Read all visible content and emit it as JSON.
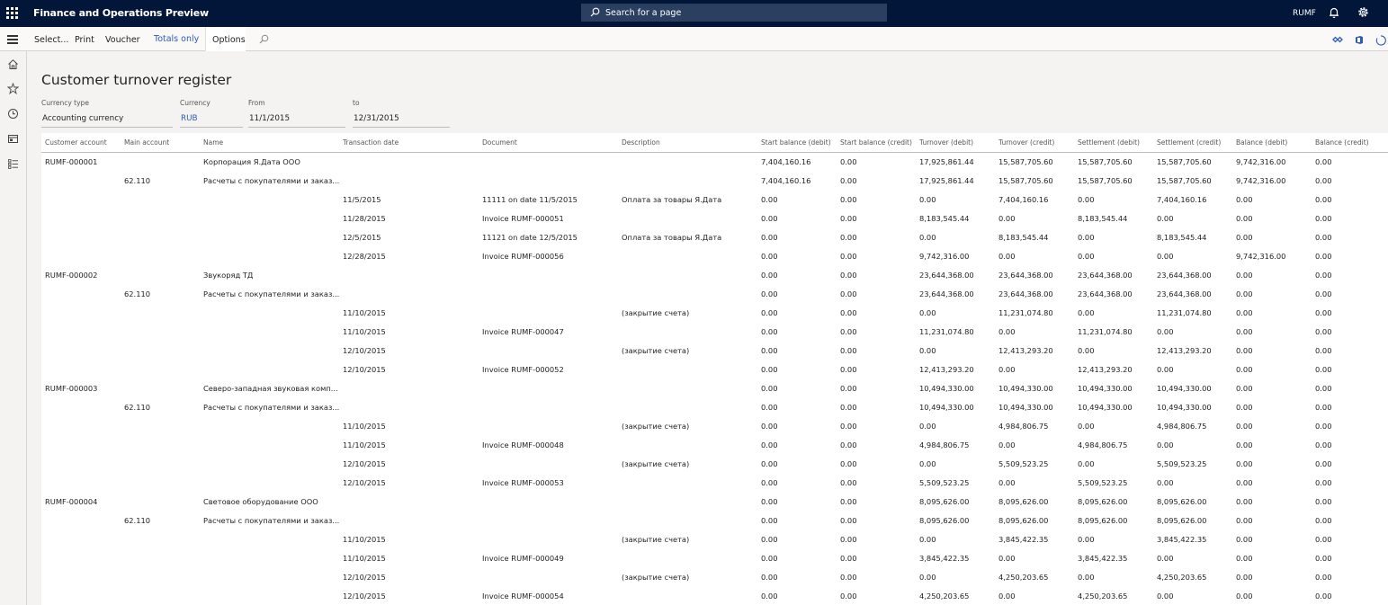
{
  "topbar": {
    "app_title": "Finance and Operations Preview",
    "search_placeholder": "Search for a page",
    "company": "RUMF"
  },
  "actions": {
    "select": "Select...",
    "print": "Print",
    "voucher": "Voucher",
    "totals_only": "Totals only",
    "options": "Options"
  },
  "page": {
    "title": "Customer turnover register"
  },
  "filters": {
    "currency_type": {
      "label": "Currency type",
      "value": "Accounting currency"
    },
    "currency": {
      "label": "Currency",
      "value": "RUB"
    },
    "from": {
      "label": "From",
      "value": "11/1/2015"
    },
    "to": {
      "label": "to",
      "value": "12/31/2015"
    }
  },
  "grid": {
    "columns": [
      "Customer account",
      "Main account",
      "Name",
      "Transaction date",
      "Document",
      "Description",
      "Start balance (debit)",
      "Start balance (credit)",
      "Turnover (debit)",
      "Turnover (credit)",
      "Settlement (debit)",
      "Settlement (credit)",
      "Balance (debit)",
      "Balance (credit)"
    ],
    "rows": [
      [
        "RUMF-000001",
        "",
        "Корпорация Я.Дата ООО",
        "",
        "",
        "",
        "7,404,160.16",
        "0.00",
        "17,925,861.44",
        "15,587,705.60",
        "15,587,705.60",
        "15,587,705.60",
        "9,742,316.00",
        "0.00"
      ],
      [
        "",
        "62.110",
        "Расчеты с покупателями и заказ...",
        "",
        "",
        "",
        "7,404,160.16",
        "0.00",
        "17,925,861.44",
        "15,587,705.60",
        "15,587,705.60",
        "15,587,705.60",
        "9,742,316.00",
        "0.00"
      ],
      [
        "",
        "",
        "",
        "11/5/2015",
        "11111 on date 11/5/2015",
        "Оплата за товары Я.Дата",
        "0.00",
        "0.00",
        "0.00",
        "7,404,160.16",
        "0.00",
        "7,404,160.16",
        "0.00",
        "0.00"
      ],
      [
        "",
        "",
        "",
        "11/28/2015",
        "Invoice RUMF-000051",
        "",
        "0.00",
        "0.00",
        "8,183,545.44",
        "0.00",
        "8,183,545.44",
        "0.00",
        "0.00",
        "0.00"
      ],
      [
        "",
        "",
        "",
        "12/5/2015",
        "11121 on date 12/5/2015",
        "Оплата за товары Я.Дата",
        "0.00",
        "0.00",
        "0.00",
        "8,183,545.44",
        "0.00",
        "8,183,545.44",
        "0.00",
        "0.00"
      ],
      [
        "",
        "",
        "",
        "12/28/2015",
        "Invoice RUMF-000056",
        "",
        "0.00",
        "0.00",
        "9,742,316.00",
        "0.00",
        "0.00",
        "0.00",
        "9,742,316.00",
        "0.00"
      ],
      [
        "RUMF-000002",
        "",
        "Звукоряд ТД",
        "",
        "",
        "",
        "0.00",
        "0.00",
        "23,644,368.00",
        "23,644,368.00",
        "23,644,368.00",
        "23,644,368.00",
        "0.00",
        "0.00"
      ],
      [
        "",
        "62.110",
        "Расчеты с покупателями и заказ...",
        "",
        "",
        "",
        "0.00",
        "0.00",
        "23,644,368.00",
        "23,644,368.00",
        "23,644,368.00",
        "23,644,368.00",
        "0.00",
        "0.00"
      ],
      [
        "",
        "",
        "",
        "11/10/2015",
        "",
        "(закрытие счета)",
        "0.00",
        "0.00",
        "0.00",
        "11,231,074.80",
        "0.00",
        "11,231,074.80",
        "0.00",
        "0.00"
      ],
      [
        "",
        "",
        "",
        "11/10/2015",
        "Invoice RUMF-000047",
        "",
        "0.00",
        "0.00",
        "11,231,074.80",
        "0.00",
        "11,231,074.80",
        "0.00",
        "0.00",
        "0.00"
      ],
      [
        "",
        "",
        "",
        "12/10/2015",
        "",
        "(закрытие счета)",
        "0.00",
        "0.00",
        "0.00",
        "12,413,293.20",
        "0.00",
        "12,413,293.20",
        "0.00",
        "0.00"
      ],
      [
        "",
        "",
        "",
        "12/10/2015",
        "Invoice RUMF-000052",
        "",
        "0.00",
        "0.00",
        "12,413,293.20",
        "0.00",
        "12,413,293.20",
        "0.00",
        "0.00",
        "0.00"
      ],
      [
        "RUMF-000003",
        "",
        "Северо-западная звуковая комп...",
        "",
        "",
        "",
        "0.00",
        "0.00",
        "10,494,330.00",
        "10,494,330.00",
        "10,494,330.00",
        "10,494,330.00",
        "0.00",
        "0.00"
      ],
      [
        "",
        "62.110",
        "Расчеты с покупателями и заказ...",
        "",
        "",
        "",
        "0.00",
        "0.00",
        "10,494,330.00",
        "10,494,330.00",
        "10,494,330.00",
        "10,494,330.00",
        "0.00",
        "0.00"
      ],
      [
        "",
        "",
        "",
        "11/10/2015",
        "",
        "(закрытие счета)",
        "0.00",
        "0.00",
        "0.00",
        "4,984,806.75",
        "0.00",
        "4,984,806.75",
        "0.00",
        "0.00"
      ],
      [
        "",
        "",
        "",
        "11/10/2015",
        "Invoice RUMF-000048",
        "",
        "0.00",
        "0.00",
        "4,984,806.75",
        "0.00",
        "4,984,806.75",
        "0.00",
        "0.00",
        "0.00"
      ],
      [
        "",
        "",
        "",
        "12/10/2015",
        "",
        "(закрытие счета)",
        "0.00",
        "0.00",
        "0.00",
        "5,509,523.25",
        "0.00",
        "5,509,523.25",
        "0.00",
        "0.00"
      ],
      [
        "",
        "",
        "",
        "12/10/2015",
        "Invoice RUMF-000053",
        "",
        "0.00",
        "0.00",
        "5,509,523.25",
        "0.00",
        "5,509,523.25",
        "0.00",
        "0.00",
        "0.00"
      ],
      [
        "RUMF-000004",
        "",
        "Световое оборудование ООО",
        "",
        "",
        "",
        "0.00",
        "0.00",
        "8,095,626.00",
        "8,095,626.00",
        "8,095,626.00",
        "8,095,626.00",
        "0.00",
        "0.00"
      ],
      [
        "",
        "62.110",
        "Расчеты с покупателями и заказ...",
        "",
        "",
        "",
        "0.00",
        "0.00",
        "8,095,626.00",
        "8,095,626.00",
        "8,095,626.00",
        "8,095,626.00",
        "0.00",
        "0.00"
      ],
      [
        "",
        "",
        "",
        "11/10/2015",
        "",
        "(закрытие счета)",
        "0.00",
        "0.00",
        "0.00",
        "3,845,422.35",
        "0.00",
        "3,845,422.35",
        "0.00",
        "0.00"
      ],
      [
        "",
        "",
        "",
        "11/10/2015",
        "Invoice RUMF-000049",
        "",
        "0.00",
        "0.00",
        "3,845,422.35",
        "0.00",
        "3,845,422.35",
        "0.00",
        "0.00",
        "0.00"
      ],
      [
        "",
        "",
        "",
        "12/10/2015",
        "",
        "(закрытие счета)",
        "0.00",
        "0.00",
        "0.00",
        "4,250,203.65",
        "0.00",
        "4,250,203.65",
        "0.00",
        "0.00"
      ],
      [
        "",
        "",
        "",
        "12/10/2015",
        "Invoice RUMF-000054",
        "",
        "0.00",
        "0.00",
        "4,250,203.65",
        "0.00",
        "4,250,203.65",
        "0.00",
        "0.00",
        "0.00"
      ]
    ]
  },
  "icons": {
    "app_launcher": "waffle-icon",
    "search": "search-icon",
    "notifications": "bell-icon",
    "settings": "gear-icon",
    "nav": [
      "hamburger-icon",
      "home-icon",
      "star-icon",
      "clock-icon",
      "workspace-icon",
      "list-icon"
    ],
    "action_right": [
      "connector-icon",
      "office-icon",
      "refresh-icon"
    ]
  },
  "colors": {
    "topbar": "#011638",
    "search_bg": "#2b3f61",
    "accent_link": "#2d5bb7"
  }
}
